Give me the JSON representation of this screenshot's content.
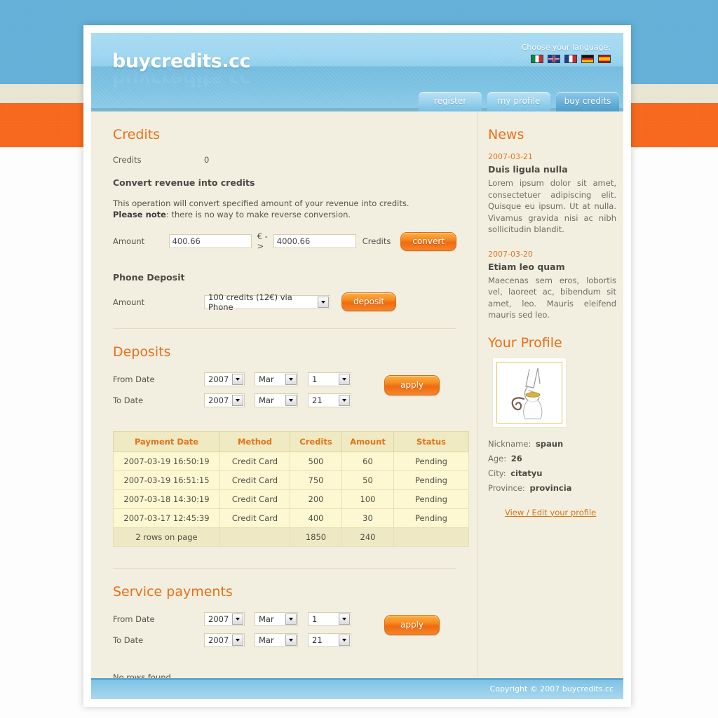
{
  "site": {
    "logo": "buycredits.cc",
    "footer": "Copyright © 2007 buycredits.cc"
  },
  "language": {
    "label": "Choose your language:",
    "flags": [
      "italy-flag",
      "uk-flag",
      "france-flag",
      "germany-flag",
      "spain-flag"
    ]
  },
  "nav": {
    "tabs": [
      {
        "label": "register",
        "active": false
      },
      {
        "label": "my profile",
        "active": false
      },
      {
        "label": "buy credits",
        "active": true
      }
    ]
  },
  "credits": {
    "heading": "Credits",
    "credits_label": "Credits",
    "credits_value": "0",
    "convert_heading": "Convert revenue into credits",
    "note_line1": "This operation will convert specified amount of your revenue into credits.",
    "note_bold": "Please note",
    "note_line2": ": there is no way to make reverse conversion.",
    "amount_label": "Amount",
    "amount_eur": "400.66",
    "arrow": "€ ->",
    "amount_credits": "4000.66",
    "credits_suffix": "Credits",
    "convert_button": "convert"
  },
  "phone_deposit": {
    "heading": "Phone Deposit",
    "amount_label": "Amount",
    "selected_option": "100 credits (12€) via Phone",
    "deposit_button": "deposit"
  },
  "deposits": {
    "heading": "Deposits",
    "from_label": "From Date",
    "to_label": "To Date",
    "from_year": "2007",
    "from_month": "Mar",
    "from_day": "1",
    "to_year": "2007",
    "to_month": "Mar",
    "to_day": "21",
    "apply_button": "apply",
    "columns": [
      "Payment Date",
      "Method",
      "Credits",
      "Amount",
      "Status"
    ],
    "rows": [
      [
        "2007-03-19 16:50:19",
        "Credit Card",
        "500",
        "60",
        "Pending"
      ],
      [
        "2007-03-19 16:51:15",
        "Credit Card",
        "750",
        "50",
        "Pending"
      ],
      [
        "2007-03-18 14:30:19",
        "Credit Card",
        "200",
        "100",
        "Pending"
      ],
      [
        "2007-03-17 12:45:39",
        "Credit Card",
        "400",
        "30",
        "Pending"
      ]
    ],
    "summary": [
      "2 rows on page",
      "",
      "1850",
      "240",
      ""
    ]
  },
  "service_payments": {
    "heading": "Service payments",
    "from_label": "From Date",
    "to_label": "To Date",
    "from_year": "2007",
    "from_month": "Mar",
    "from_day": "1",
    "to_year": "2007",
    "to_month": "Mar",
    "to_day": "21",
    "apply_button": "apply",
    "empty_message": "No rows found"
  },
  "news": {
    "heading": "News",
    "items": [
      {
        "date": "2007-03-21",
        "title": "Duis ligula nulla",
        "body": "Lorem ipsum dolor sit amet, consectetuer adipiscing elit. Quisque eu ipsum. Ut at nulla. Vivamus gravida nisi ac nibh sollicitudin blandit."
      },
      {
        "date": "2007-03-20",
        "title": "Etiam leo quam",
        "body": "Maecenas sem eros, lobortis vel, laoreet ac, bibendum sit amet, leo. Mauris eleifend mauris sed leo."
      }
    ]
  },
  "profile": {
    "heading": "Your Profile",
    "avatar": "cat-sketch-avatar",
    "nickname_label": "Nickname:",
    "nickname": "spaun",
    "age_label": "Age:",
    "age": "26",
    "city_label": "City:",
    "city": "citatyu",
    "province_label": "Province:",
    "province": "provincia",
    "edit_link": "View / Edit your profile"
  },
  "colors": {
    "accent_orange": "#e8701a",
    "header_blue": "#8fcfec",
    "page_bg": "#f2efe0",
    "table_header": "#efeac2",
    "table_row": "#fdf8d2"
  }
}
